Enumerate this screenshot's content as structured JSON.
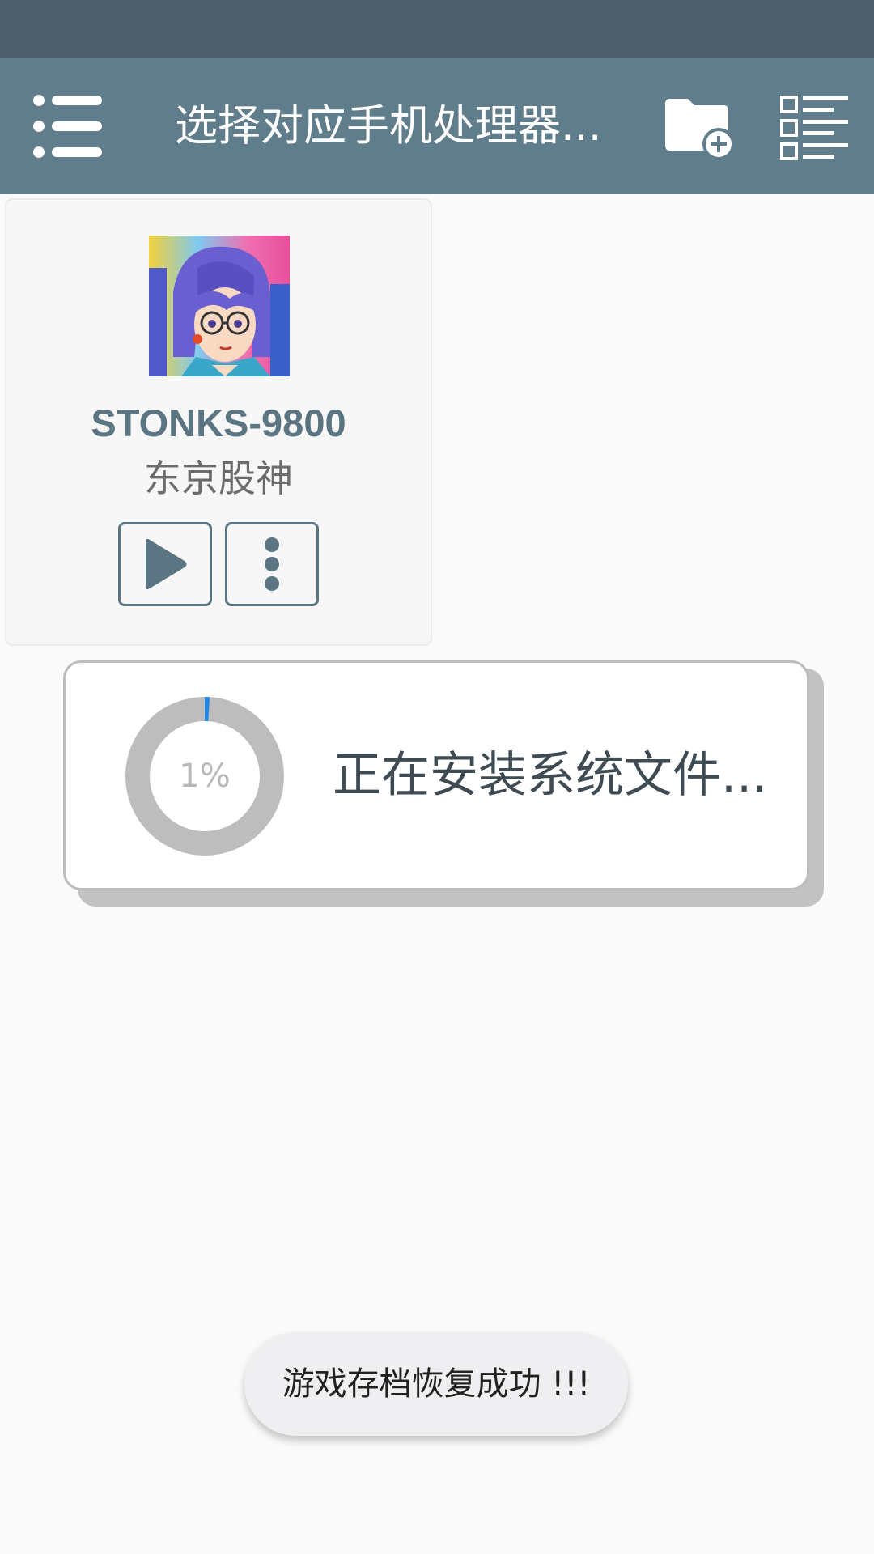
{
  "app_bar": {
    "title": "选择对应手机处理器...",
    "menu_icon": "menu-icon",
    "folder_icon": "folder-add-icon",
    "list_icon": "list-view-icon",
    "background_color": "#607d8b",
    "status_bar_color": "#4b5e69"
  },
  "game": {
    "id": "STONKS-9800",
    "name": "东京股神",
    "play_icon": "play-icon",
    "more_icon": "more-vertical-icon"
  },
  "progress": {
    "percent_label": "1%",
    "percent_value": 1,
    "message": "正在安装系统文件..."
  },
  "toast": {
    "message": "游戏存档恢复成功 !!!"
  },
  "colors": {
    "accent": "#5c7582",
    "progress_arc": "#1e88e5",
    "progress_track": "#bdbdbd"
  }
}
